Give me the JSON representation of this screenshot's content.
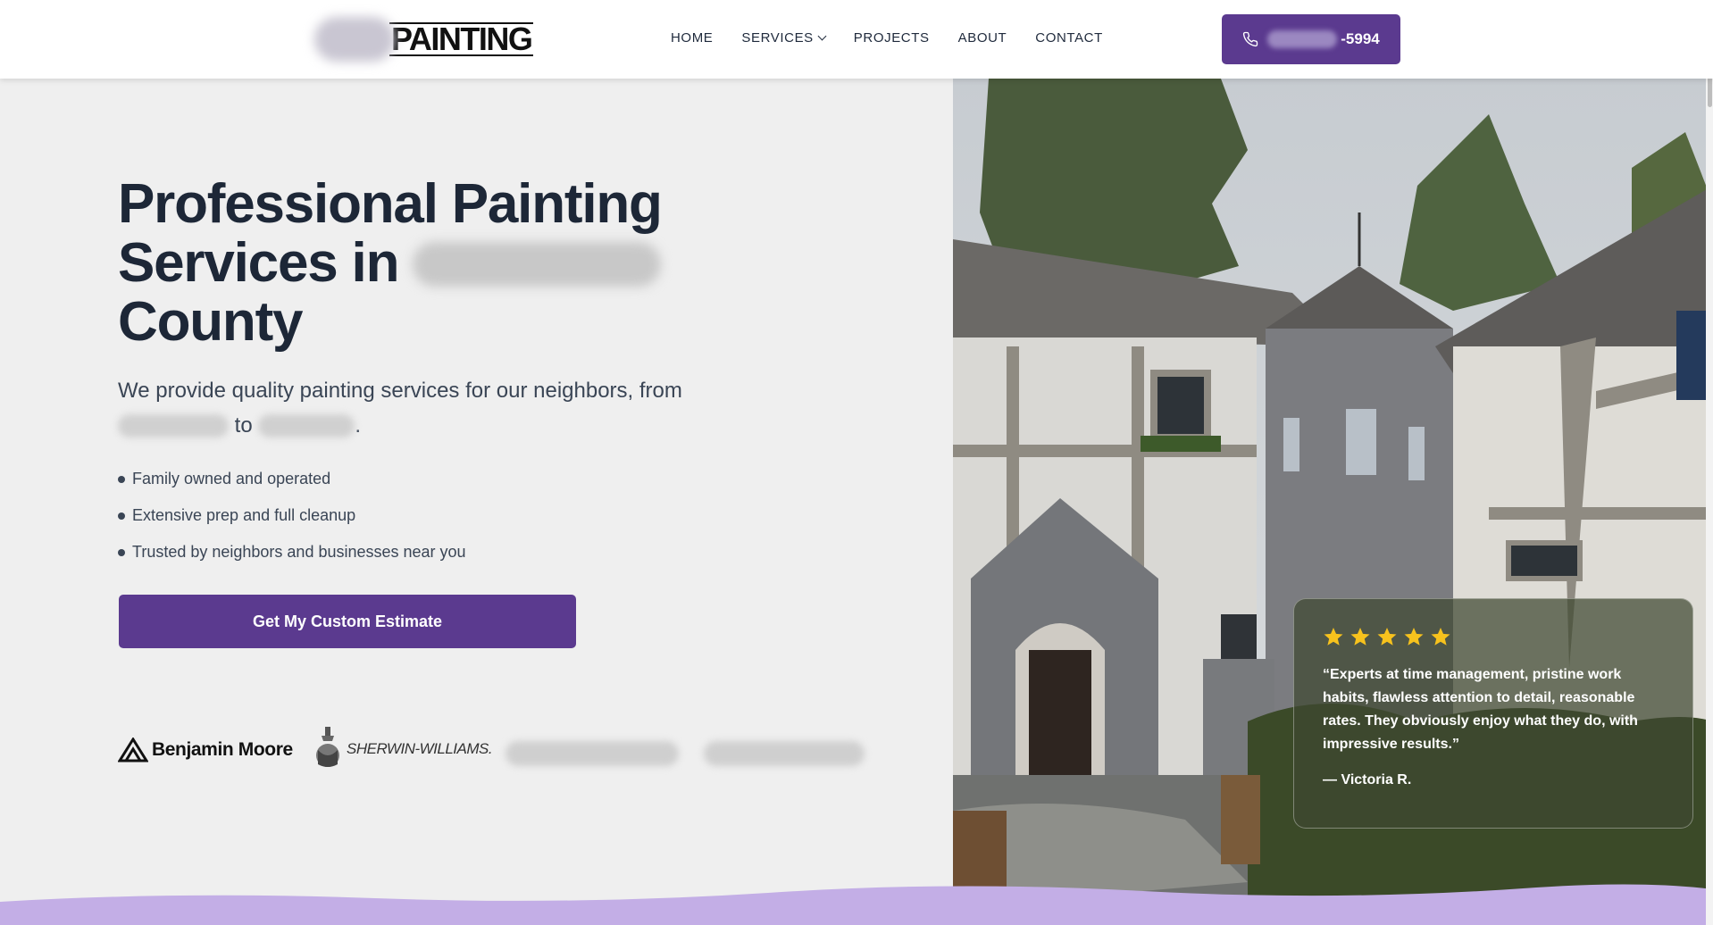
{
  "header": {
    "logo_text": "PAINTING",
    "nav": [
      {
        "label": "HOME"
      },
      {
        "label": "SERVICES"
      },
      {
        "label": "PROJECTS"
      },
      {
        "label": "ABOUT"
      },
      {
        "label": "CONTACT"
      }
    ],
    "phone_suffix": "-5994"
  },
  "hero": {
    "title_line1": "Professional Painting",
    "title_line2_prefix": "Services in",
    "title_line3": "County",
    "subtitle_start": "We provide quality painting services for our neighbors, from",
    "subtitle_to": "to",
    "subtitle_end": ".",
    "bullets": [
      "Family owned and operated",
      "Extensive prep and full cleanup",
      "Trusted by neighbors and businesses near you"
    ],
    "cta_label": "Get My Custom Estimate"
  },
  "brands": {
    "benjamin_moore": "Benjamin Moore",
    "sherwin_williams": "SHERWIN-WILLIAMS."
  },
  "review": {
    "rating": 5,
    "quote": "“Experts at time management, pristine work habits, flawless attention to detail, reasonable rates. They obviously enjoy what they do, with impressive results.”",
    "author": "— Victoria R."
  },
  "colors": {
    "brand_purple": "#5b3a8f",
    "wave_lavender": "#c3aee6",
    "star_yellow": "#f7c21d"
  }
}
